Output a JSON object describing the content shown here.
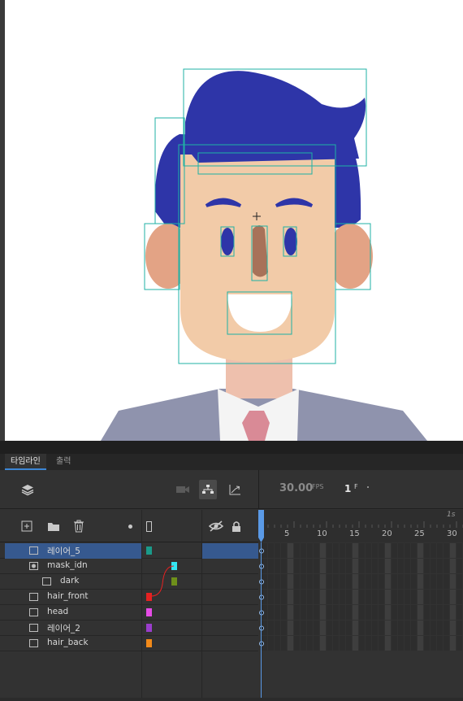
{
  "panel": {
    "tabs": [
      {
        "label": "타임라인",
        "active": true
      },
      {
        "label": "출력",
        "active": false
      }
    ],
    "fps_value": "30.00",
    "fps_unit": "FPS",
    "current_frame": "1",
    "frame_unit": "F",
    "ruler_labels": [
      "5",
      "10",
      "15",
      "20",
      "25",
      "30"
    ],
    "ruler_seconds_label": "1s",
    "playhead_frame": 1
  },
  "layers": [
    {
      "name": "레이어_5",
      "type": "normal",
      "color": "#1a9a8a",
      "selected": true,
      "indent": 0
    },
    {
      "name": "mask_idn",
      "type": "mask",
      "color": "#33e6f2",
      "selected": false,
      "indent": 0
    },
    {
      "name": "dark",
      "type": "masked",
      "color": "#6e8f1a",
      "selected": false,
      "indent": 1
    },
    {
      "name": "hair_front",
      "type": "normal",
      "color": "#e52121",
      "selected": false,
      "indent": 0
    },
    {
      "name": "head",
      "type": "normal",
      "color": "#e64ce6",
      "selected": false,
      "indent": 0
    },
    {
      "name": "레이어_2",
      "type": "normal",
      "color": "#9a3dcc",
      "selected": false,
      "indent": 0
    },
    {
      "name": "hair_back",
      "type": "normal",
      "color": "#f28a1a",
      "selected": false,
      "indent": 0
    }
  ],
  "colors": {
    "hair": "#2e35a8",
    "skin": "#f2cba8",
    "ear": "#e3a385",
    "nose": "#a87259",
    "eye": "#2e35a8",
    "suit": "#8f93ad",
    "tie": "#d98a96",
    "bbox": "#1fb2a5",
    "accent": "#3c86d6"
  },
  "icons": {
    "layers": "layers-icon",
    "camera": "camera-icon",
    "hierarchy": "hierarchy-icon",
    "ease": "ease-graph-icon",
    "new_layer": "add-layer-icon",
    "new_folder": "folder-icon",
    "delete": "trash-icon",
    "highlight": "dot-icon",
    "outline": "outline-icon",
    "visibility": "eye-hidden-icon",
    "lock": "lock-icon"
  }
}
